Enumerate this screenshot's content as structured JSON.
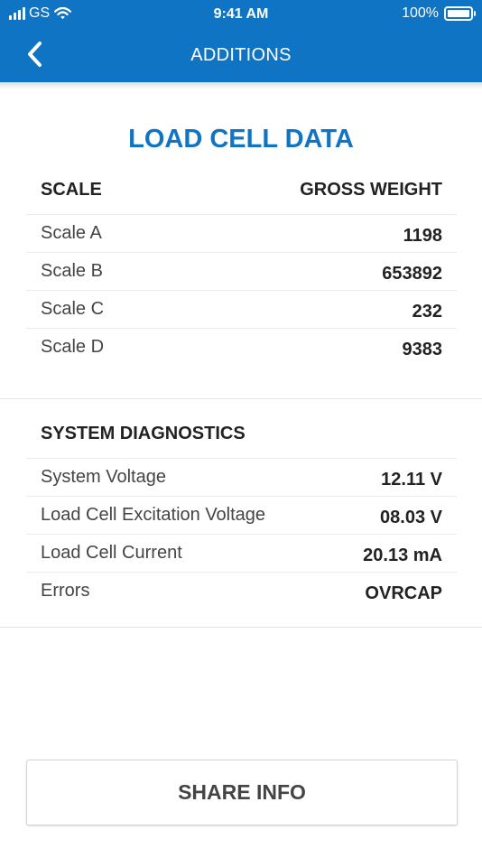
{
  "status_bar": {
    "carrier": "GS",
    "time": "9:41 AM",
    "battery": "100%",
    "battery_level": 1.0
  },
  "nav": {
    "back_icon": "chevron-left-icon",
    "title": "ADDITIONS"
  },
  "load_cell": {
    "title": "LOAD CELL DATA",
    "headers": [
      "SCALE",
      "GROSS WEIGHT"
    ],
    "rows": [
      {
        "label": "Scale A",
        "value": "1198"
      },
      {
        "label": "Scale B",
        "value": "653892"
      },
      {
        "label": "Scale C",
        "value": "232"
      },
      {
        "label": "Scale D",
        "value": "9383"
      }
    ]
  },
  "diagnostics": {
    "title": "SYSTEM DIAGNOSTICS",
    "rows": [
      {
        "label": "System Voltage",
        "value": "12.11 V"
      },
      {
        "label": "Load Cell Excitation Voltage",
        "value": "08.03 V"
      },
      {
        "label": "Load Cell Current",
        "value": "20.13 mA"
      },
      {
        "label": "Errors",
        "value": "OVRCAP"
      }
    ]
  },
  "share_button": {
    "label": "SHARE INFO"
  },
  "colors": {
    "primary": "#0f74c3",
    "text": "#333333",
    "divider": "#e6e6e6"
  }
}
